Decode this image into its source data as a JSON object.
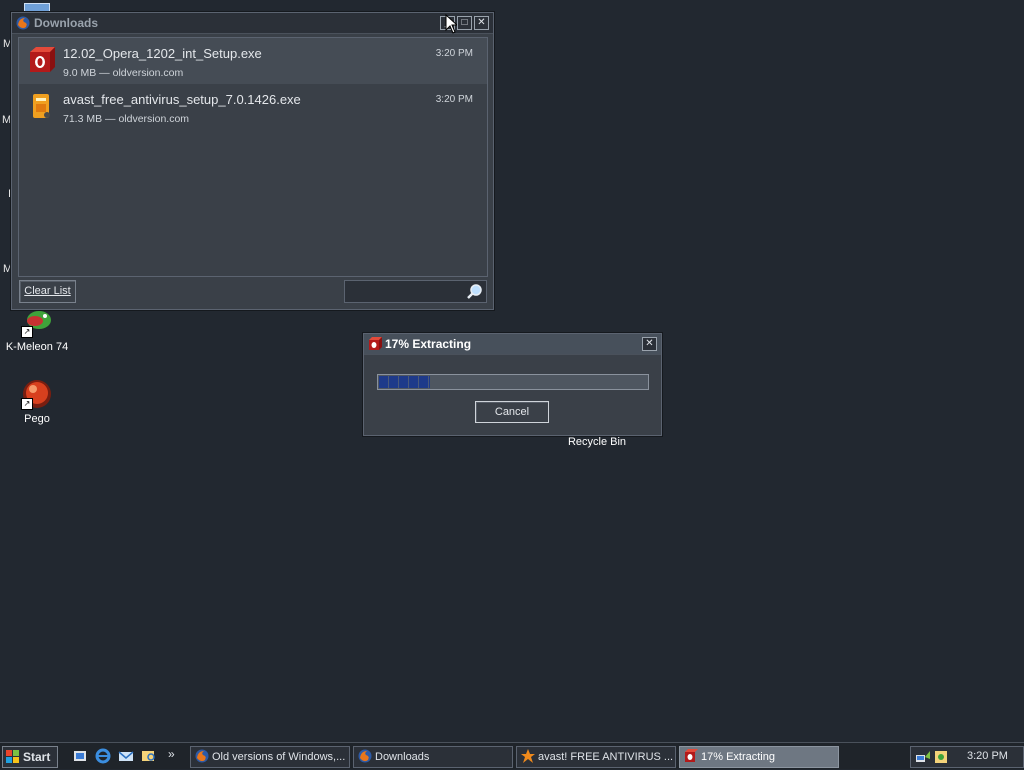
{
  "desktop": {
    "edge_letters": [
      "M",
      "M",
      "I",
      "M"
    ],
    "icons": [
      {
        "label": "K-Meleon 74",
        "icon": "k-meleon-icon"
      },
      {
        "label": "Pego",
        "icon": "pego-icon"
      },
      {
        "label": "Recycle Bin",
        "icon": "recycle-bin-icon"
      }
    ]
  },
  "downloads_window": {
    "title": "Downloads",
    "items": [
      {
        "name": "12.02_Opera_1202_int_Setup.exe",
        "meta": "9.0 MB — oldversion.com",
        "time": "3:20 PM",
        "icon": "opera-installer-icon"
      },
      {
        "name": "avast_free_antivirus_setup_7.0.1426.exe",
        "meta": "71.3 MB — oldversion.com",
        "time": "3:20 PM",
        "icon": "avast-installer-icon"
      }
    ],
    "clear_list": "Clear List",
    "search": {
      "placeholder": "",
      "value": "",
      "icon": "search-icon"
    }
  },
  "extract_dialog": {
    "title": "17% Extracting",
    "progress_fraction": 0.17,
    "cancel": "Cancel"
  },
  "taskbar": {
    "start": "Start",
    "overflow": "»",
    "tasks": [
      {
        "label": "Old versions of Windows,...",
        "icon": "firefox-icon",
        "active": false
      },
      {
        "label": "Downloads",
        "icon": "firefox-icon",
        "active": false
      },
      {
        "label": "avast! FREE ANTIVIRUS ...",
        "icon": "avast-icon",
        "active": false
      },
      {
        "label": "17% Extracting",
        "icon": "opera-icon",
        "active": true
      }
    ],
    "clock": "3:20 PM"
  },
  "colors": {
    "desktop": "#222830",
    "window": "#3a4048",
    "progress_fill": "#1e3a8a",
    "active_task": "#6e7782"
  }
}
